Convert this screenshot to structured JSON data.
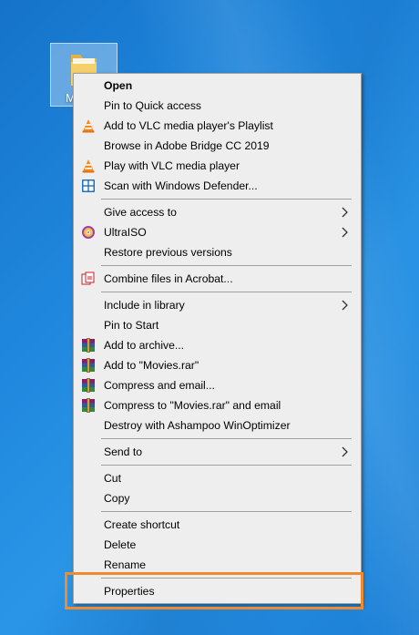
{
  "desktop": {
    "folder_label": "M"
  },
  "menu": {
    "groups": [
      [
        {
          "label": "Open",
          "bold": true,
          "icon": ""
        },
        {
          "label": "Pin to Quick access",
          "icon": ""
        },
        {
          "label": "Add to VLC media player's Playlist",
          "icon": "vlc-icon"
        },
        {
          "label": "Browse in Adobe Bridge CC 2019",
          "icon": ""
        },
        {
          "label": "Play with VLC media player",
          "icon": "vlc-icon"
        },
        {
          "label": "Scan with Windows Defender...",
          "icon": "windows-defender-icon"
        }
      ],
      [
        {
          "label": "Give access to",
          "icon": "",
          "submenu": true
        },
        {
          "label": "UltraISO",
          "icon": "ultraiso-icon",
          "submenu": true
        },
        {
          "label": "Restore previous versions",
          "icon": ""
        }
      ],
      [
        {
          "label": "Combine files in Acrobat...",
          "icon": "acrobat-icon"
        }
      ],
      [
        {
          "label": "Include in library",
          "icon": "",
          "submenu": true
        },
        {
          "label": "Pin to Start",
          "icon": ""
        },
        {
          "label": "Add to archive...",
          "icon": "winrar-icon"
        },
        {
          "label": "Add to \"Movies.rar\"",
          "icon": "winrar-icon"
        },
        {
          "label": "Compress and email...",
          "icon": "winrar-icon"
        },
        {
          "label": "Compress to \"Movies.rar\" and email",
          "icon": "winrar-icon"
        },
        {
          "label": "Destroy with Ashampoo WinOptimizer",
          "icon": ""
        }
      ],
      [
        {
          "label": "Send to",
          "icon": "",
          "submenu": true
        }
      ],
      [
        {
          "label": "Cut",
          "icon": ""
        },
        {
          "label": "Copy",
          "icon": ""
        }
      ],
      [
        {
          "label": "Create shortcut",
          "icon": ""
        },
        {
          "label": "Delete",
          "icon": ""
        },
        {
          "label": "Rename",
          "icon": ""
        }
      ],
      [
        {
          "label": "Properties",
          "icon": "",
          "highlighted": true
        }
      ]
    ]
  },
  "colors": {
    "highlight": "#f08a2c",
    "menu_bg": "#eeeeee"
  }
}
